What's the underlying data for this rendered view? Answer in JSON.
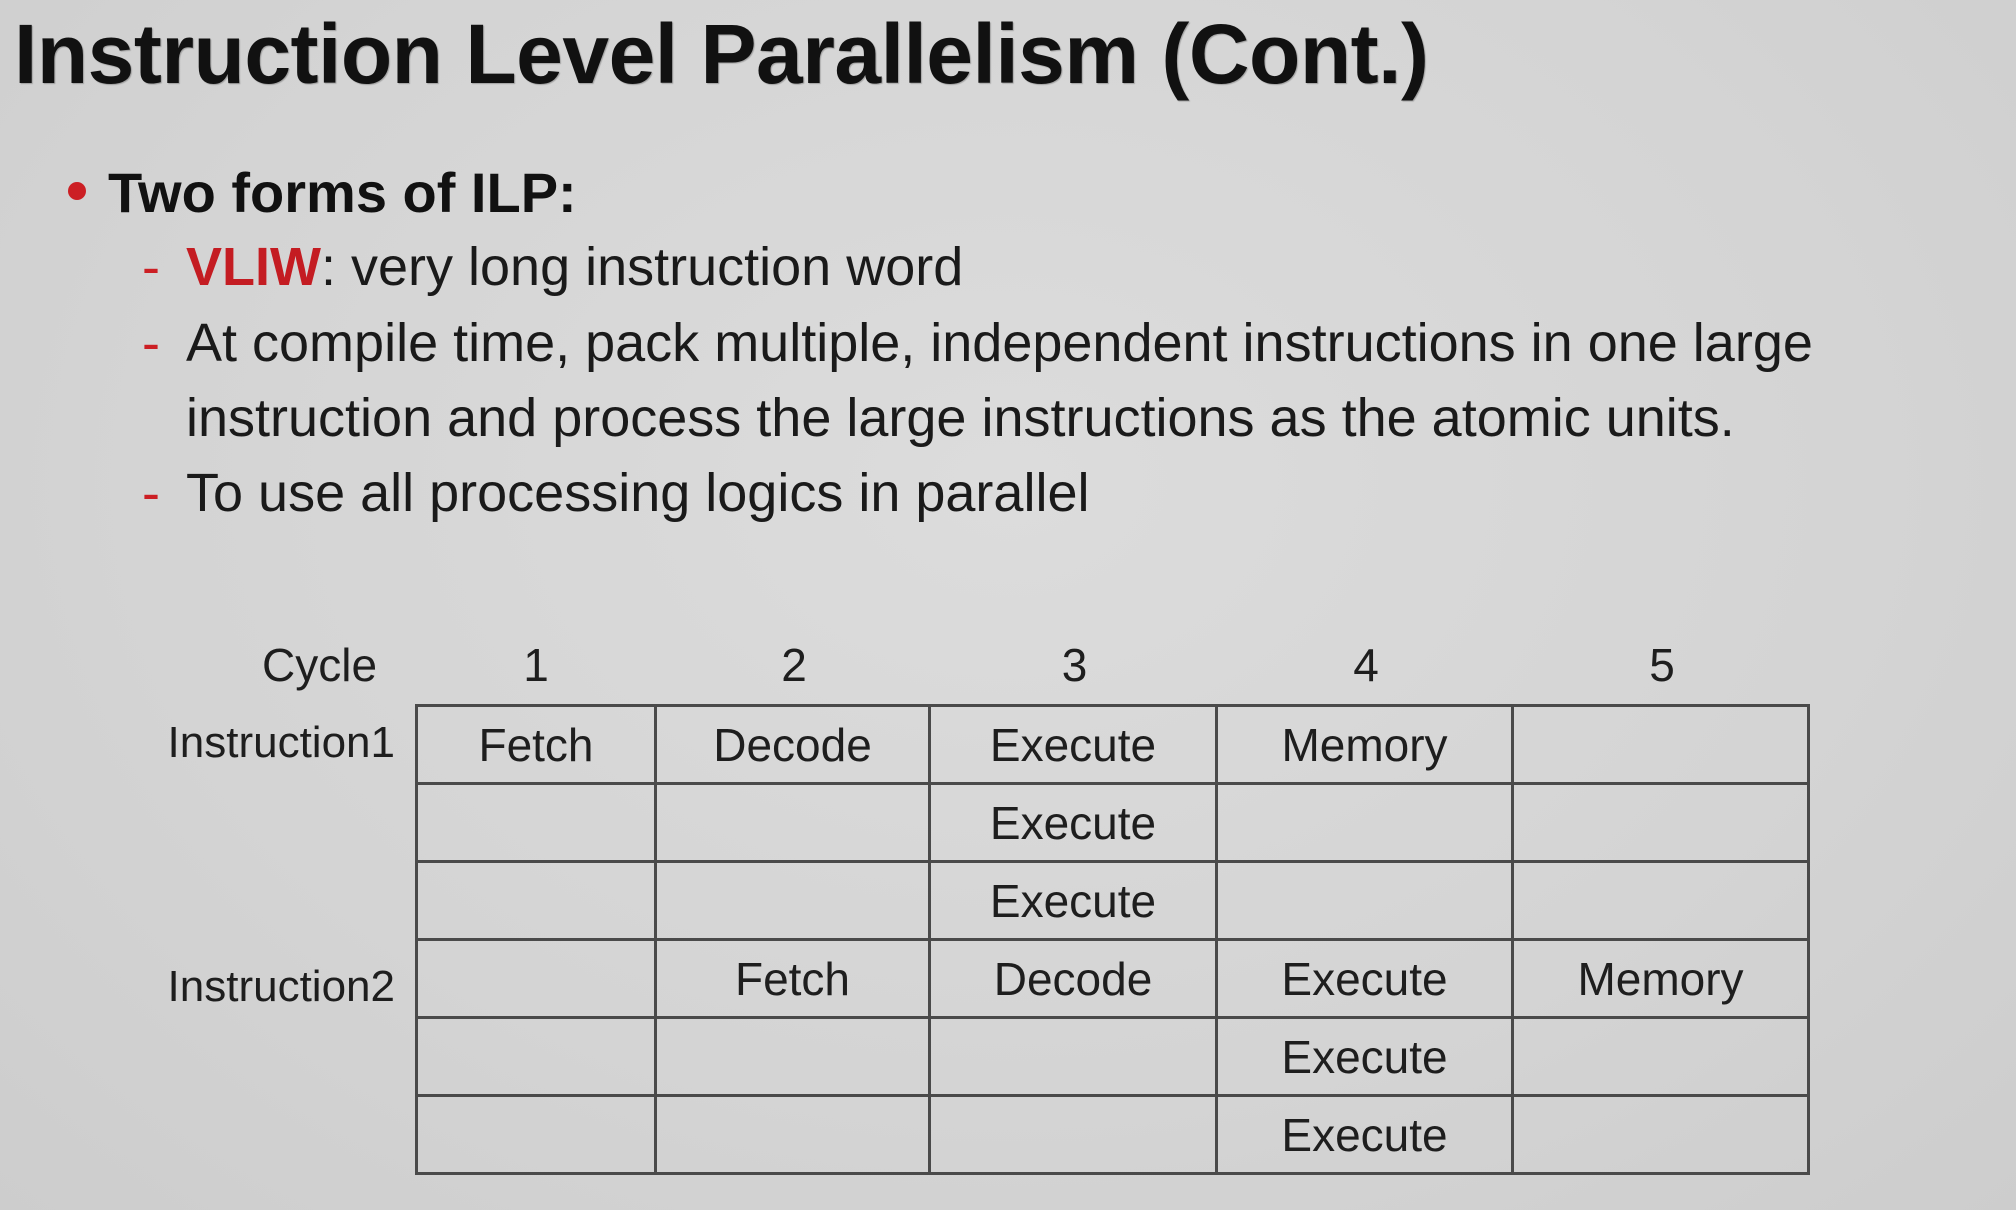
{
  "slide": {
    "title": "Instruction Level Parallelism (Cont.)",
    "bullet": "Two forms of ILP:",
    "sub_items": [
      {
        "term": "VLIW",
        "text": ": very long instruction word"
      },
      {
        "line1": "At compile time, pack multiple, independent instructions in one large",
        "line2": "instruction and process the large instructions as the atomic units."
      },
      {
        "text": "To use all processing logics in parallel"
      }
    ],
    "dash": "-",
    "accent_color": "#c41c22"
  },
  "pipeline_table": {
    "corner_label": "Cycle",
    "cycles": [
      "1",
      "2",
      "3",
      "4",
      "5"
    ],
    "row_labels": [
      "Instruction1",
      "Instruction2"
    ],
    "rows": [
      [
        "Fetch",
        "Decode",
        "Execute",
        "Memory",
        ""
      ],
      [
        "",
        "",
        "Execute",
        "",
        ""
      ],
      [
        "",
        "",
        "Execute",
        "",
        ""
      ],
      [
        "",
        "Fetch",
        "Decode",
        "Execute",
        "Memory"
      ],
      [
        "",
        "",
        "",
        "Execute",
        ""
      ],
      [
        "",
        "",
        "",
        "Execute",
        ""
      ]
    ]
  }
}
